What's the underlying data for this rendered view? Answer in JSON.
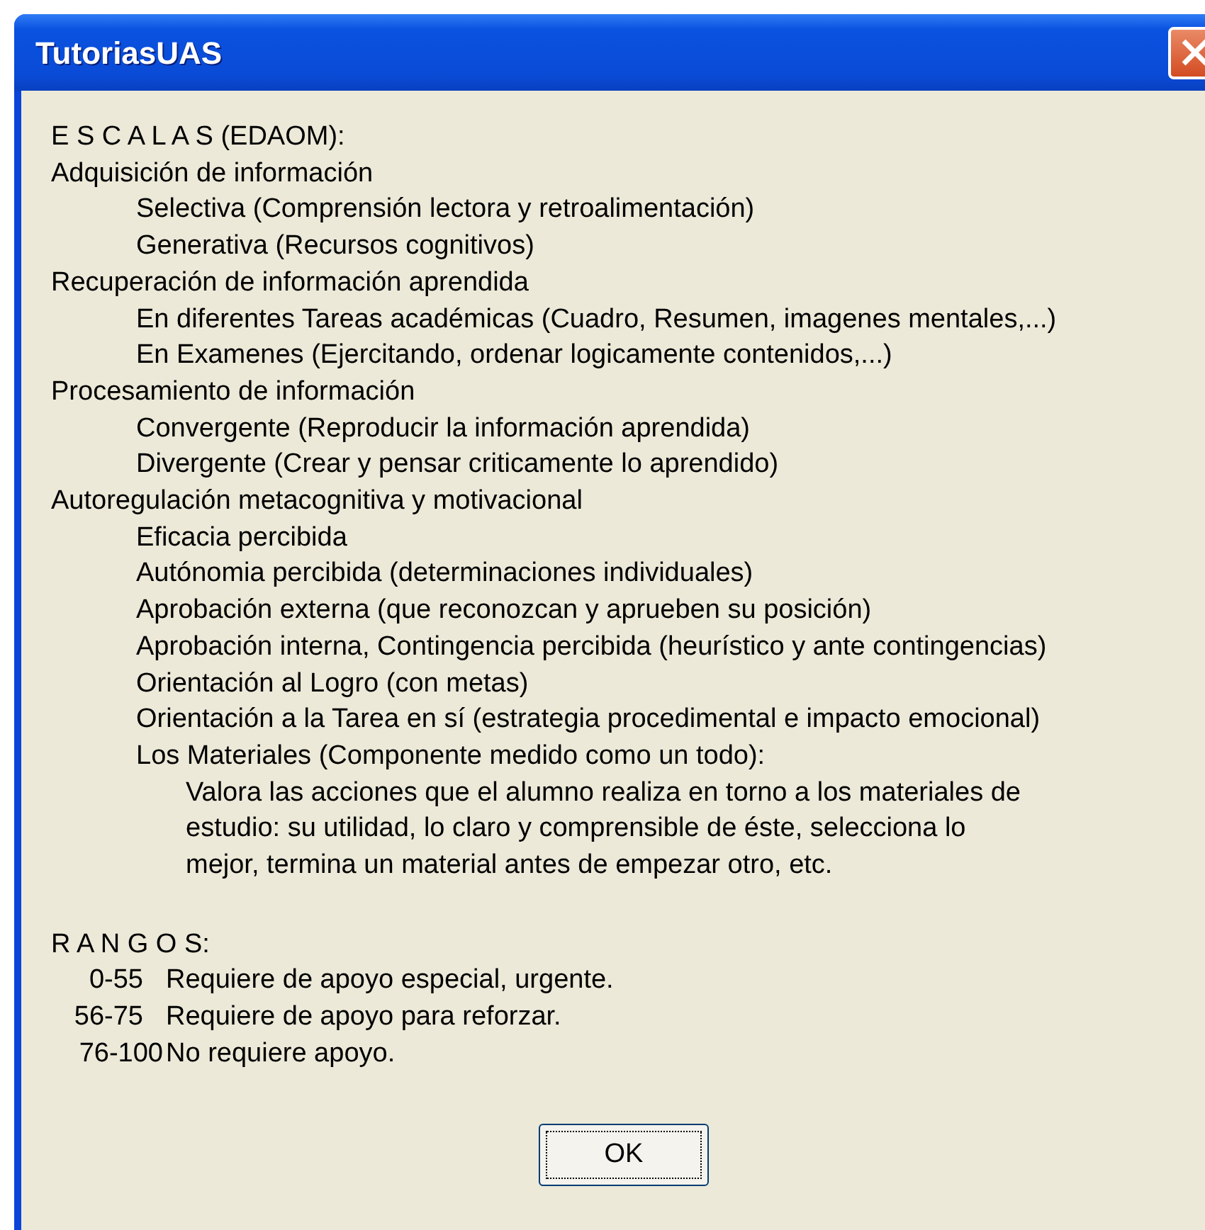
{
  "window": {
    "title": "TutoriasUAS"
  },
  "scales_heading": "E S C A L A S (EDAOM):",
  "scales": [
    {
      "label": "Adquisición de información",
      "children": [
        {
          "label": "Selectiva (Comprensión lectora y retroalimentación)"
        },
        {
          "label": "Generativa (Recursos cognitivos)"
        }
      ]
    },
    {
      "label": "Recuperación de información aprendida",
      "children": [
        {
          "label": "En diferentes Tareas académicas (Cuadro, Resumen, imagenes mentales,...)"
        },
        {
          "label": "En Examenes (Ejercitando, ordenar logicamente contenidos,...)"
        }
      ]
    },
    {
      "label": "Procesamiento de información",
      "children": [
        {
          "label": "Convergente (Reproducir la información aprendida)"
        },
        {
          "label": "Divergente (Crear y pensar criticamente lo aprendido)"
        }
      ]
    },
    {
      "label": "Autoregulación metacognitiva y motivacional",
      "children": [
        {
          "label": "Eficacia percibida"
        },
        {
          "label": "Autónomia percibida (determinaciones individuales)"
        },
        {
          "label": "Aprobación externa (que reconozcan y aprueben su posición)"
        },
        {
          "label": "Aprobación interna, Contingencia percibida (heurístico y ante contingencias)"
        },
        {
          "label": "Orientación al Logro (con metas)"
        },
        {
          "label": "Orientación a la Tarea en sí (estrategia procedimental e impacto emocional)"
        },
        {
          "label": "Los Materiales (Componente medido como un todo):",
          "children": [
            {
              "label": "Valora las acciones que el alumno realiza en torno a los materiales de"
            },
            {
              "label": "estudio: su utilidad, lo claro y comprensible de éste, selecciona lo"
            },
            {
              "label": "mejor, termina un material antes de empezar otro, etc."
            }
          ]
        }
      ]
    }
  ],
  "ranges_heading": "R A N G O S:",
  "ranges": [
    {
      "range": "0-55",
      "description": "Requiere de apoyo especial, urgente."
    },
    {
      "range": "56-75",
      "description": "Requiere de apoyo para reforzar."
    },
    {
      "range": "76-100",
      "description": "No requiere apoyo."
    }
  ],
  "buttons": [
    {
      "label": "OK",
      "focused": true
    }
  ]
}
